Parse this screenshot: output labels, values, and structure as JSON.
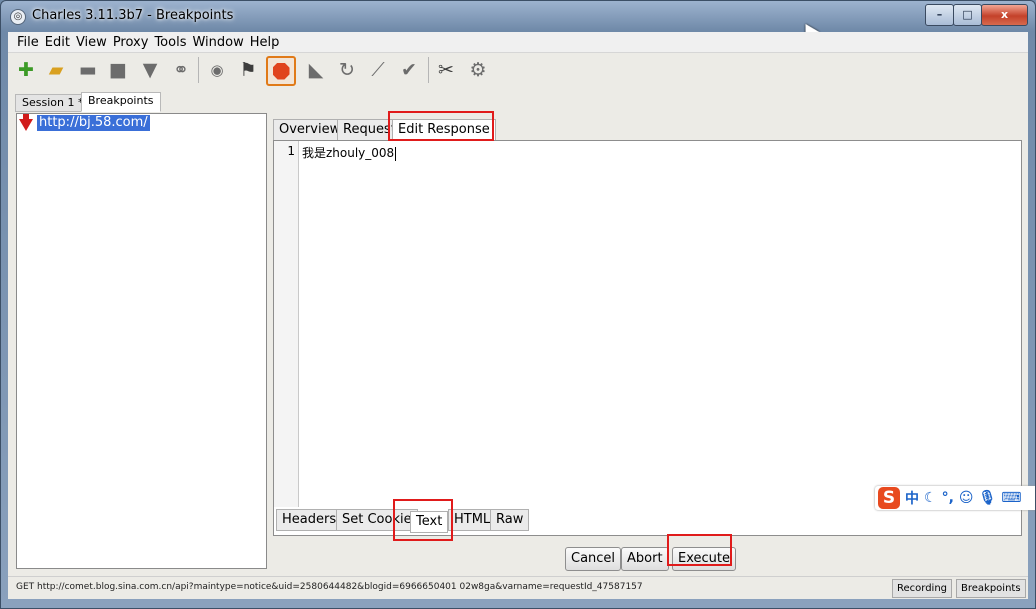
{
  "window": {
    "title": "Charles 3.11.3b7 - Breakpoints",
    "min_label": "–",
    "max_label": "□",
    "close_label": "x"
  },
  "menu": [
    "File",
    "Edit",
    "View",
    "Proxy",
    "Tools",
    "Window",
    "Help"
  ],
  "toolbar_icons": [
    "new-session-icon",
    "open-icon",
    "save-icon",
    "save-disk-icon",
    "trash-icon",
    "binoculars-icon",
    "record-icon",
    "throttle-flag-icon",
    "stop-breakpoints-icon",
    "compose-icon",
    "repeat-icon",
    "edit-pencil-icon",
    "validate-check-icon",
    "tools-icon",
    "settings-gear-icon"
  ],
  "session_tabs": [
    "Session 1 *",
    "Breakpoints"
  ],
  "tree": {
    "selected_url": "http://bj.58.com/"
  },
  "top_tabs": [
    "Overview",
    "Request",
    "Edit Response"
  ],
  "editor": {
    "line_number": "1",
    "content": "我是zhouly_008"
  },
  "bottom_tabs": [
    "Headers",
    "Set Cookie",
    "Text",
    "HTML",
    "Raw"
  ],
  "buttons": {
    "cancel": "Cancel",
    "abort": "Abort",
    "execute": "Execute"
  },
  "status": {
    "text": "GET http://comet.blog.sina.com.cn/api?maintype=notice&uid=2580644482&blogid=6966650401 02w8ga&varname=requestId_47587157",
    "recording": "Recording",
    "breakpoints": "Breakpoints"
  },
  "ime": {
    "logo": "S",
    "items": [
      "中",
      "☾",
      "°,",
      "☺",
      "🎙",
      "⌨"
    ]
  }
}
